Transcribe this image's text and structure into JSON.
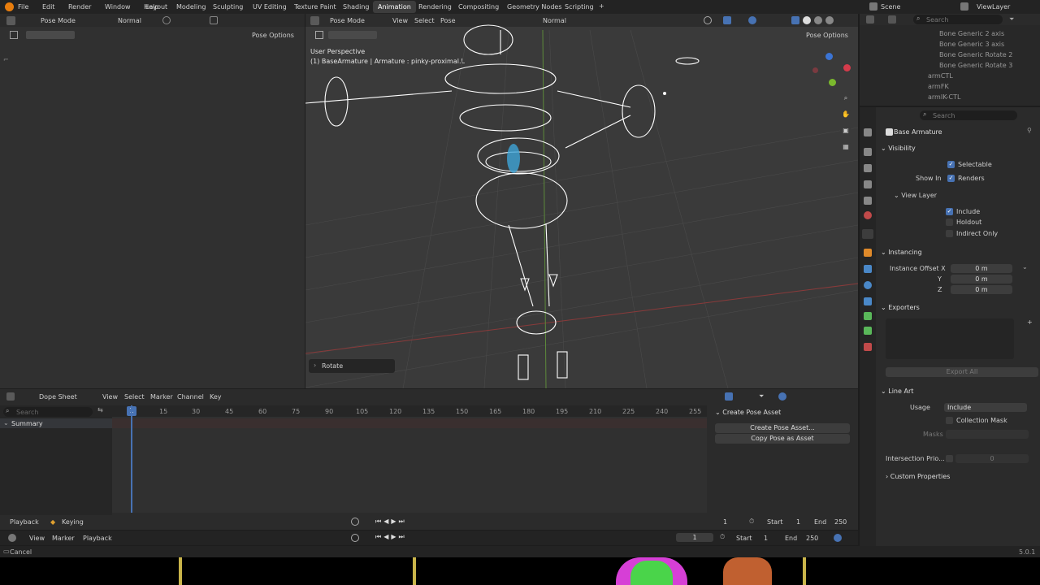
{
  "topbar": {
    "menus": [
      "File",
      "Edit",
      "Render",
      "Window",
      "Help"
    ],
    "workspaces": [
      "Layout",
      "Modeling",
      "Sculpting",
      "UV Editing",
      "Texture Paint",
      "Shading",
      "Animation",
      "Rendering",
      "Compositing",
      "Geometry Nodes",
      "Scripting"
    ],
    "active_workspace": "Animation",
    "scene": "Scene",
    "view_layer": "ViewLayer"
  },
  "left_view": {
    "mode": "Pose Mode",
    "orientation": "Normal",
    "pose_options": "Pose Options"
  },
  "viewport": {
    "mode": "Pose Mode",
    "menus": [
      "View",
      "Select",
      "Pose"
    ],
    "orientation": "Normal",
    "pose_options": "Pose Options",
    "perspective": "User Perspective",
    "object_info": "(1) BaseArmature | Armature : pinky-proximal.L",
    "last_op": "Rotate"
  },
  "outliner": {
    "search_placeholder": "Search",
    "items": [
      "Bone Generic 2 axis",
      "Bone Generic 3 axis",
      "Bone Generic Rotate 2",
      "Bone Generic Rotate 3",
      "armCTL",
      "armFK",
      "armIK-CTL"
    ]
  },
  "properties": {
    "search_placeholder": "Search",
    "object_name": "Base Armature",
    "visibility": {
      "title": "Visibility",
      "selectable": "Selectable",
      "show_in": "Show In",
      "renders": "Renders",
      "view_layer": "View Layer",
      "include": "Include",
      "holdout": "Holdout",
      "indirect_only": "Indirect Only"
    },
    "instancing": {
      "title": "Instancing",
      "offset_label": "Instance Offset X",
      "y_label": "Y",
      "z_label": "Z",
      "x": "0 m",
      "y": "0 m",
      "z": "0 m"
    },
    "exporters": {
      "title": "Exporters",
      "export_all": "Export All"
    },
    "line_art": {
      "title": "Line Art",
      "usage_label": "Usage",
      "usage": "Include",
      "collection_mask": "Collection Mask",
      "masks": "Masks",
      "intersection_label": "Intersection Prio...",
      "intersection_value": "0"
    },
    "custom_properties": "Custom Properties"
  },
  "dopesheet": {
    "editor": "Dope Sheet",
    "menus": [
      "View",
      "Select",
      "Marker",
      "Channel",
      "Key"
    ],
    "search_placeholder": "Search",
    "summary": "Summary",
    "current_frame": "1",
    "ticks": [
      "15",
      "30",
      "45",
      "60",
      "75",
      "90",
      "105",
      "120",
      "135",
      "150",
      "165",
      "180",
      "195",
      "210",
      "225",
      "240",
      "255"
    ],
    "sidebar_title": "Create Pose Asset",
    "create_pose": "Create Pose Asset...",
    "copy_pose": "Copy Pose as Asset",
    "playback": "Playback",
    "keying": "Keying",
    "frame": "1",
    "start_label": "Start",
    "start": "1",
    "end_label": "End",
    "end": "250"
  },
  "timeline": {
    "menus": [
      "View",
      "Marker",
      "Playback"
    ],
    "frame": "1",
    "start_label": "Start",
    "start": "1",
    "end_label": "End",
    "end": "250"
  },
  "statusbar": {
    "left": "Cancel",
    "version": "5.0.1"
  }
}
